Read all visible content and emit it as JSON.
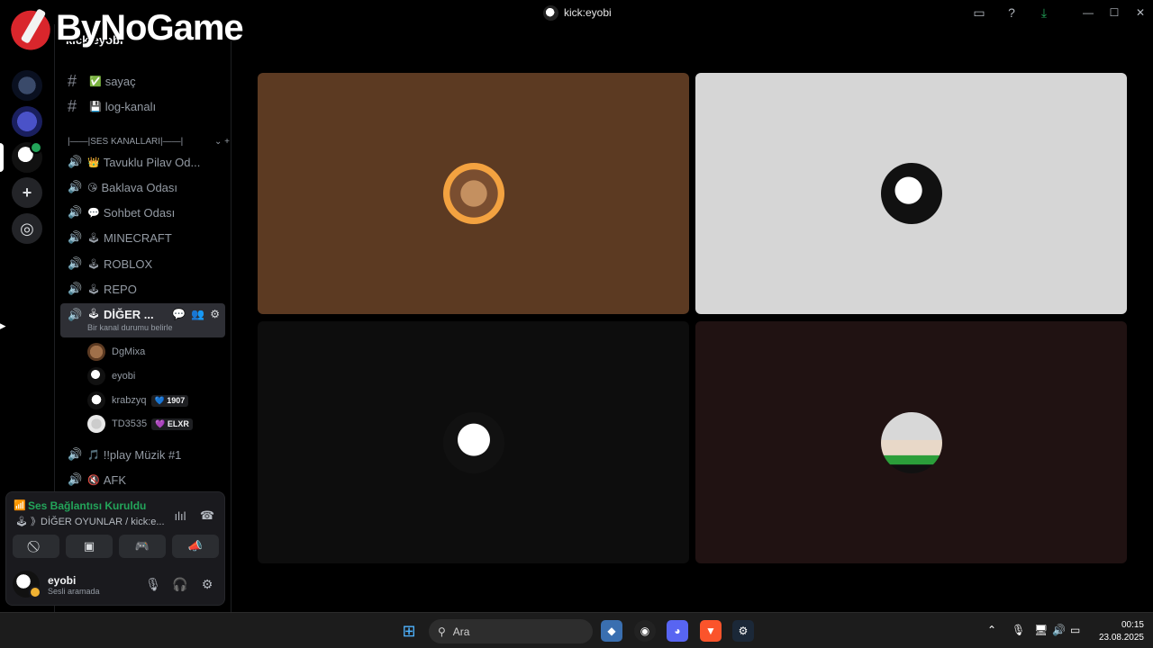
{
  "window": {
    "title": "kick:eyobi"
  },
  "logo": {
    "text": "ByNoGame"
  },
  "server": {
    "name": "kick:eyobi"
  },
  "channels": {
    "text": [
      {
        "name": "sayaç",
        "emoji": "✅"
      },
      {
        "name": "log-kanalı",
        "emoji": "💾"
      }
    ],
    "category": "|——|SES KANALLARI|——|",
    "voice": [
      {
        "name": "Tavuklu Pilav Od...",
        "emoji": "👑"
      },
      {
        "name": "Baklava Odası",
        "emoji": "😘"
      },
      {
        "name": "Sohbet Odası",
        "emoji": "💬"
      },
      {
        "name": "MINECRAFT",
        "emoji": "🕹"
      },
      {
        "name": "ROBLOX",
        "emoji": "🕹"
      },
      {
        "name": "REPO",
        "emoji": "🕹"
      }
    ],
    "active": {
      "name": "DİĞER ...",
      "emoji": "🕹",
      "status": "Bir kanal durumu belirle"
    },
    "voice_users": [
      {
        "name": "DgMixa",
        "tag": ""
      },
      {
        "name": "eyobi",
        "tag": ""
      },
      {
        "name": "krabzyq",
        "tag": "💙 1907"
      },
      {
        "name": "TD3535",
        "tag": "💜 ELXR"
      }
    ],
    "voice_after": [
      {
        "name": "!!play Müzik #1",
        "emoji": "🎵"
      },
      {
        "name": "AFK",
        "emoji": "🔇"
      }
    ]
  },
  "voice_panel": {
    "status": "Ses Bağlantısı Kuruldu",
    "channel": "🕹 》DİĞER OYUNLAR / kick:e...",
    "user": {
      "name": "eyobi",
      "status": "Sesli aramada"
    }
  },
  "taskbar": {
    "search_placeholder": "Ara",
    "time": "00:15",
    "date": "23.08.2025"
  },
  "colors": {
    "tile1": "#5c3a22",
    "tile2": "#d6d6d6",
    "tile3": "#0d0d0d",
    "tile4": "#201212",
    "connected": "#23a55a"
  }
}
